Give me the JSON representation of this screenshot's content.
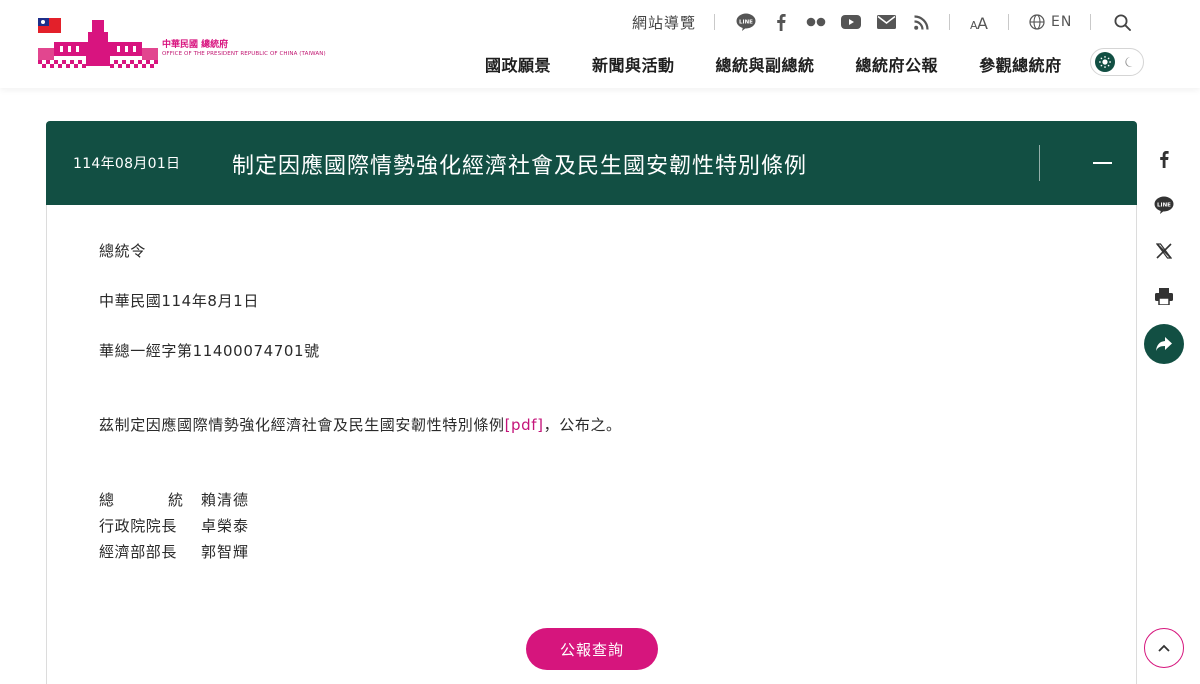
{
  "header": {
    "logo": {
      "name_zh": "中華民國 總統府",
      "name_en": "OFFICE OF THE PRESIDENT REPUBLIC OF CHINA (TAIWAN)"
    },
    "topbar": {
      "sitemap_label": "網站導覽",
      "social_icons": [
        "line-icon",
        "facebook-icon",
        "flickr-icon",
        "youtube-icon",
        "mail-icon",
        "rss-icon"
      ],
      "font_size_label": "A",
      "language_label": "EN",
      "search_icon": "search-icon"
    },
    "nav": [
      {
        "label": "國政願景"
      },
      {
        "label": "新聞與活動"
      },
      {
        "label": "總統與副總統"
      },
      {
        "label": "總統府公報"
      },
      {
        "label": "參觀總統府"
      }
    ],
    "theme_toggle": {
      "active": "light"
    }
  },
  "article": {
    "date": "114年08月01日",
    "title": "制定因應國際情勢強化經濟社會及民生國安韌性特別條例",
    "order_type": "總統令",
    "order_date": "中華民國114年8月1日",
    "order_number": "華總一經字第11400074701號",
    "statement_prefix": "茲制定因應國際情勢強化經濟社會及民生國安韌性特別條例",
    "statement_link": "[pdf]",
    "statement_suffix": "，公布之。",
    "signatures": [
      {
        "role_chars": [
          "總",
          "統"
        ],
        "name": "賴清德"
      },
      {
        "role": "行政院院長",
        "name": "卓榮泰"
      },
      {
        "role": "經濟部部長",
        "name": "郭智輝"
      }
    ],
    "gazette_button": "公報查詢"
  },
  "share_rail": [
    "facebook-icon",
    "line-icon",
    "x-icon",
    "print-icon",
    "share-icon"
  ],
  "colors": {
    "primary_green": "#124f43",
    "accent_magenta": "#d6157d"
  }
}
